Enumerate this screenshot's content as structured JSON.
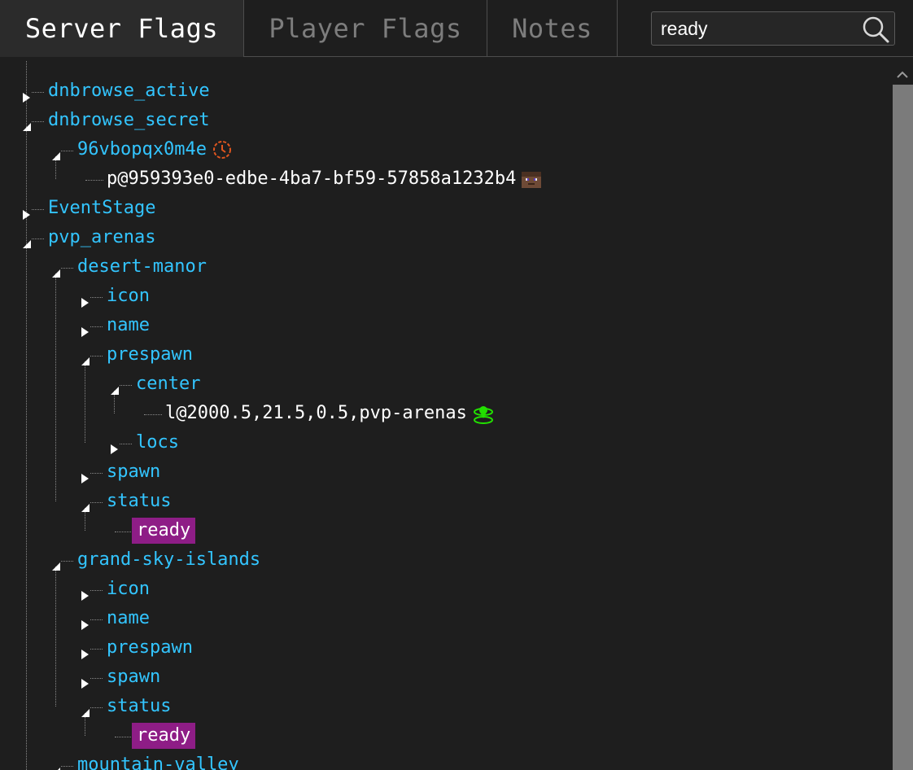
{
  "tabs": [
    {
      "label": "Server Flags",
      "active": true
    },
    {
      "label": "Player Flags",
      "active": false
    },
    {
      "label": "Notes",
      "active": false
    }
  ],
  "search": {
    "value": "ready",
    "icon": "search-icon"
  },
  "tree": [
    {
      "depth": 0,
      "kind": "key",
      "label": "dnbrowse_active",
      "expanded": false
    },
    {
      "depth": 0,
      "kind": "key",
      "label": "dnbrowse_secret",
      "expanded": true
    },
    {
      "depth": 1,
      "kind": "key",
      "label": "96vbopqx0m4e",
      "expanded": true,
      "icon": "expiry-clock-icon"
    },
    {
      "depth": 2,
      "kind": "value",
      "label": "p@959393e0-edbe-4ba7-bf59-57858a1232b4",
      "icon": "player-head-icon"
    },
    {
      "depth": 0,
      "kind": "key",
      "label": "EventStage",
      "expanded": false
    },
    {
      "depth": 0,
      "kind": "key",
      "label": "pvp_arenas",
      "expanded": true
    },
    {
      "depth": 1,
      "kind": "key",
      "label": "desert-manor",
      "expanded": true
    },
    {
      "depth": 2,
      "kind": "key",
      "label": "icon",
      "expanded": false
    },
    {
      "depth": 2,
      "kind": "key",
      "label": "name",
      "expanded": false
    },
    {
      "depth": 2,
      "kind": "key",
      "label": "prespawn",
      "expanded": true
    },
    {
      "depth": 3,
      "kind": "key",
      "label": "center",
      "expanded": true
    },
    {
      "depth": 4,
      "kind": "value",
      "label": "l@2000.5,21.5,0.5,pvp-arenas",
      "icon": "location-icon"
    },
    {
      "depth": 3,
      "kind": "key",
      "label": "locs",
      "expanded": false
    },
    {
      "depth": 2,
      "kind": "key",
      "label": "spawn",
      "expanded": false
    },
    {
      "depth": 2,
      "kind": "key",
      "label": "status",
      "expanded": true
    },
    {
      "depth": 3,
      "kind": "match",
      "label": "ready"
    },
    {
      "depth": 1,
      "kind": "key",
      "label": "grand-sky-islands",
      "expanded": true
    },
    {
      "depth": 2,
      "kind": "key",
      "label": "icon",
      "expanded": false
    },
    {
      "depth": 2,
      "kind": "key",
      "label": "name",
      "expanded": false
    },
    {
      "depth": 2,
      "kind": "key",
      "label": "prespawn",
      "expanded": false
    },
    {
      "depth": 2,
      "kind": "key",
      "label": "spawn",
      "expanded": false
    },
    {
      "depth": 2,
      "kind": "key",
      "label": "status",
      "expanded": true
    },
    {
      "depth": 3,
      "kind": "match",
      "label": "ready"
    },
    {
      "depth": 1,
      "kind": "key",
      "label": "mountain-valley",
      "expanded": true
    }
  ],
  "colors": {
    "background": "#1e1e1e",
    "key_text": "#33c5ff",
    "value_text": "#ffffff",
    "match_highlight": "#8e1d86",
    "clock_icon": "#e0561f",
    "location_icon": "#22e000",
    "scrollbar_thumb": "#7b7b7b"
  },
  "scrollbar": {
    "up_icon": "chevron-up-icon"
  }
}
